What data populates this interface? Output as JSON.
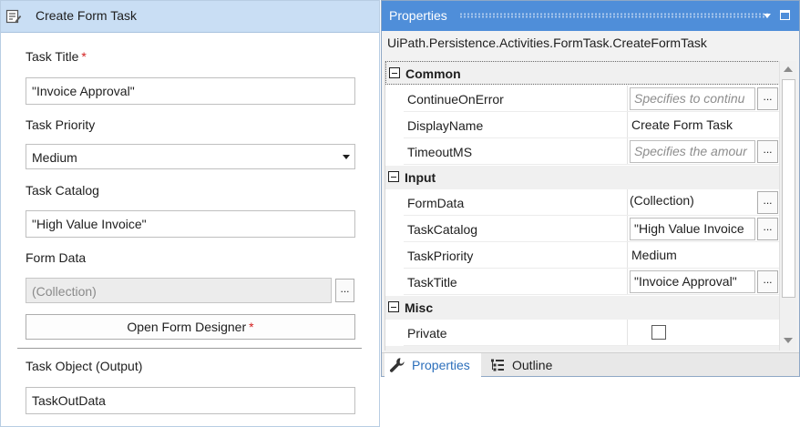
{
  "activity": {
    "title": "Create Form Task",
    "task_title": {
      "label": "Task Title",
      "required_mark": "*",
      "value": "\"Invoice Approval\""
    },
    "task_priority": {
      "label": "Task Priority",
      "value": "Medium"
    },
    "task_catalog": {
      "label": "Task Catalog",
      "value": "\"High Value Invoice\""
    },
    "form_data": {
      "label": "Form Data",
      "value": "(Collection)",
      "button": "..."
    },
    "open_designer": {
      "label": "Open Form Designer",
      "required_mark": "*"
    },
    "task_object": {
      "label": "Task Object (Output)",
      "value": "TaskOutData"
    }
  },
  "properties": {
    "title": "Properties",
    "type_name": "UiPath.Persistence.Activities.FormTask.CreateFormTask",
    "categories": [
      {
        "name": "Common",
        "rows": [
          {
            "name": "ContinueOnError",
            "placeholder": "Specifies to continu",
            "button": "..."
          },
          {
            "name": "DisplayName",
            "value": "Create Form Task"
          },
          {
            "name": "TimeoutMS",
            "placeholder": "Specifies the amour",
            "button": "..."
          }
        ]
      },
      {
        "name": "Input",
        "rows": [
          {
            "name": "FormData",
            "value": "(Collection)",
            "button": "..."
          },
          {
            "name": "TaskCatalog",
            "value": "\"High Value Invoice",
            "button": "..."
          },
          {
            "name": "TaskPriority",
            "value": "Medium"
          },
          {
            "name": "TaskTitle",
            "value": "\"Invoice Approval\"",
            "button": "..."
          }
        ]
      },
      {
        "name": "Misc",
        "rows": [
          {
            "name": "Private",
            "checked": false
          }
        ]
      }
    ],
    "tabs": [
      {
        "label": "Properties",
        "icon": "wrench-icon",
        "active": true
      },
      {
        "label": "Outline",
        "icon": "outline-tree-icon",
        "active": false
      }
    ]
  },
  "colors": {
    "title_bar": "#4f8ed9",
    "activity_header": "#c9def4",
    "required": "#d32020",
    "active_tab_text": "#2c6fbb"
  }
}
